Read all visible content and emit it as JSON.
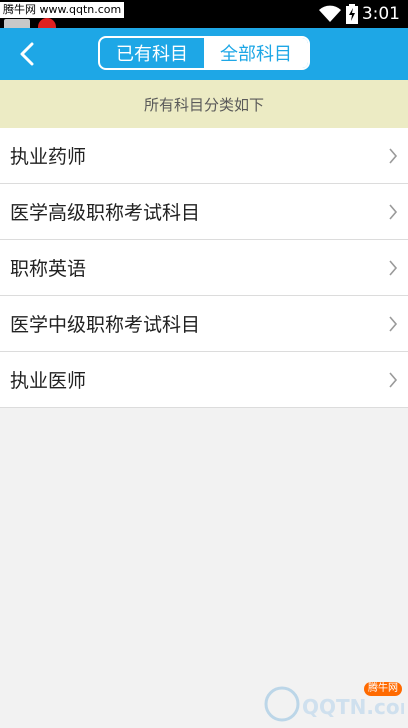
{
  "status_bar": {
    "watermark_text": "腾牛网 www.qqtn.com",
    "time": "3:01"
  },
  "header": {
    "back_icon": "chevron-left-icon",
    "tabs": [
      {
        "label": "已有科目",
        "active": false
      },
      {
        "label": "全部科目",
        "active": true
      }
    ],
    "background_color": "#1ea7e6"
  },
  "banner": {
    "text": "所有科目分类如下",
    "background_color": "#ecebc4"
  },
  "list": {
    "items": [
      {
        "label": "执业药师"
      },
      {
        "label": "医学高级职称考试科目"
      },
      {
        "label": "职称英语"
      },
      {
        "label": "医学中级职称考试科目"
      },
      {
        "label": "执业医师"
      }
    ],
    "item_icon": "chevron-right-icon"
  },
  "watermark_logo": {
    "text": "QQTN.com",
    "badge": "腾牛网"
  }
}
